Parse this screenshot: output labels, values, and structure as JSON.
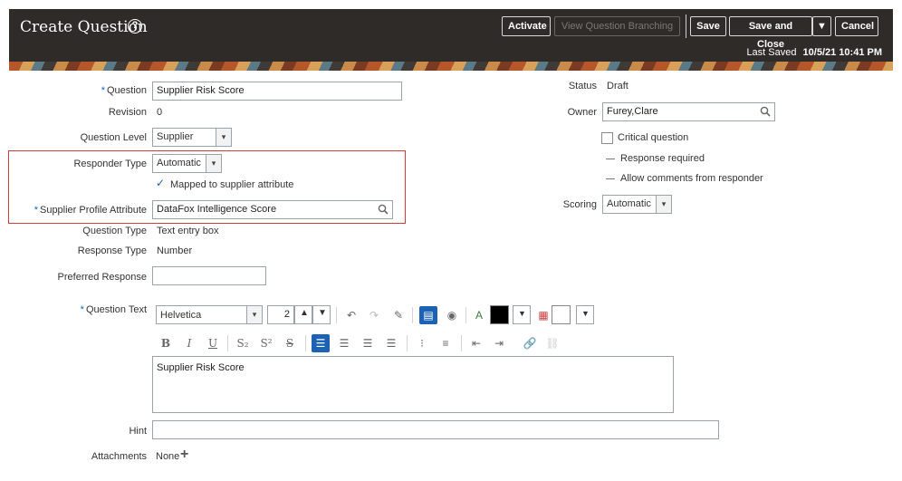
{
  "header": {
    "title": "Create Question",
    "buttons": {
      "activate": "Activate",
      "view_branching": "View Question Branching",
      "save": "Save",
      "save_close": "Save and Close",
      "cancel": "Cancel"
    },
    "last_saved_label": "Last Saved",
    "last_saved_value": "10/5/21 10:41 PM"
  },
  "form": {
    "question": {
      "label": "Question",
      "value": "Supplier Risk Score"
    },
    "revision": {
      "label": "Revision",
      "value": "0"
    },
    "question_level": {
      "label": "Question Level",
      "value": "Supplier"
    },
    "responder_type": {
      "label": "Responder Type",
      "value": "Automatic"
    },
    "mapped": {
      "label": "Mapped to supplier attribute"
    },
    "supplier_profile_attribute": {
      "label": "Supplier Profile Attribute",
      "value": "DataFox Intelligence Score"
    },
    "question_type": {
      "label": "Question Type",
      "value": "Text entry box"
    },
    "response_type": {
      "label": "Response Type",
      "value": "Number"
    },
    "preferred_response": {
      "label": "Preferred Response",
      "value": ""
    },
    "question_text": {
      "label": "Question Text",
      "value": "Supplier Risk Score"
    },
    "hint": {
      "label": "Hint",
      "value": ""
    },
    "attachments": {
      "label": "Attachments",
      "value": "None"
    }
  },
  "right": {
    "status": {
      "label": "Status",
      "value": "Draft"
    },
    "owner": {
      "label": "Owner",
      "value": "Furey,Clare"
    },
    "critical": {
      "label": "Critical question"
    },
    "response_required": {
      "label": "Response required"
    },
    "allow_comments": {
      "label": "Allow comments from responder"
    },
    "scoring": {
      "label": "Scoring",
      "value": "Automatic"
    }
  },
  "editor": {
    "font": "Helvetica",
    "size": "2",
    "colors": {
      "text": "#000000",
      "background": "#ffffff"
    }
  }
}
